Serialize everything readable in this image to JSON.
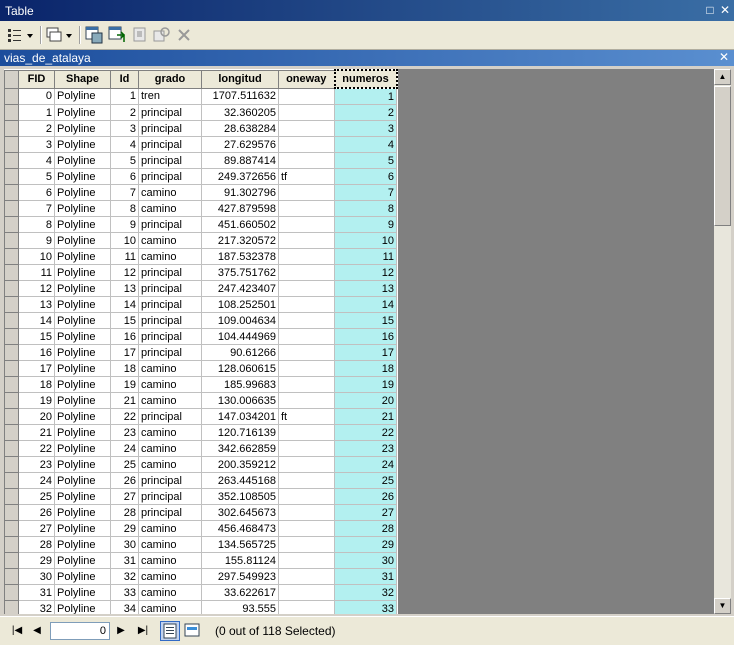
{
  "window": {
    "title": "Table"
  },
  "tab": {
    "title": "vias_de_atalaya"
  },
  "columns": [
    "FID",
    "Shape",
    "Id",
    "grado",
    "longitud",
    "oneway",
    "numeros"
  ],
  "rows": [
    [
      "0",
      "Polyline",
      "1",
      "tren",
      "1707.511632",
      "",
      "1"
    ],
    [
      "1",
      "Polyline",
      "2",
      "principal",
      "32.360205",
      "",
      "2"
    ],
    [
      "2",
      "Polyline",
      "3",
      "principal",
      "28.638284",
      "",
      "3"
    ],
    [
      "3",
      "Polyline",
      "4",
      "principal",
      "27.629576",
      "",
      "4"
    ],
    [
      "4",
      "Polyline",
      "5",
      "principal",
      "89.887414",
      "",
      "5"
    ],
    [
      "5",
      "Polyline",
      "6",
      "principal",
      "249.372656",
      "tf",
      "6"
    ],
    [
      "6",
      "Polyline",
      "7",
      "camino",
      "91.302796",
      "",
      "7"
    ],
    [
      "7",
      "Polyline",
      "8",
      "camino",
      "427.879598",
      "",
      "8"
    ],
    [
      "8",
      "Polyline",
      "9",
      "principal",
      "451.660502",
      "",
      "9"
    ],
    [
      "9",
      "Polyline",
      "10",
      "camino",
      "217.320572",
      "",
      "10"
    ],
    [
      "10",
      "Polyline",
      "11",
      "camino",
      "187.532378",
      "",
      "11"
    ],
    [
      "11",
      "Polyline",
      "12",
      "principal",
      "375.751762",
      "",
      "12"
    ],
    [
      "12",
      "Polyline",
      "13",
      "principal",
      "247.423407",
      "",
      "13"
    ],
    [
      "13",
      "Polyline",
      "14",
      "principal",
      "108.252501",
      "",
      "14"
    ],
    [
      "14",
      "Polyline",
      "15",
      "principal",
      "109.004634",
      "",
      "15"
    ],
    [
      "15",
      "Polyline",
      "16",
      "principal",
      "104.444969",
      "",
      "16"
    ],
    [
      "16",
      "Polyline",
      "17",
      "principal",
      "90.61266",
      "",
      "17"
    ],
    [
      "17",
      "Polyline",
      "18",
      "camino",
      "128.060615",
      "",
      "18"
    ],
    [
      "18",
      "Polyline",
      "19",
      "camino",
      "185.99683",
      "",
      "19"
    ],
    [
      "19",
      "Polyline",
      "21",
      "camino",
      "130.006635",
      "",
      "20"
    ],
    [
      "20",
      "Polyline",
      "22",
      "principal",
      "147.034201",
      "ft",
      "21"
    ],
    [
      "21",
      "Polyline",
      "23",
      "camino",
      "120.716139",
      "",
      "22"
    ],
    [
      "22",
      "Polyline",
      "24",
      "camino",
      "342.662859",
      "",
      "23"
    ],
    [
      "23",
      "Polyline",
      "25",
      "camino",
      "200.359212",
      "",
      "24"
    ],
    [
      "24",
      "Polyline",
      "26",
      "principal",
      "263.445168",
      "",
      "25"
    ],
    [
      "25",
      "Polyline",
      "27",
      "principal",
      "352.108505",
      "",
      "26"
    ],
    [
      "26",
      "Polyline",
      "28",
      "principal",
      "302.645673",
      "",
      "27"
    ],
    [
      "27",
      "Polyline",
      "29",
      "camino",
      "456.468473",
      "",
      "28"
    ],
    [
      "28",
      "Polyline",
      "30",
      "camino",
      "134.565725",
      "",
      "29"
    ],
    [
      "29",
      "Polyline",
      "31",
      "camino",
      "155.81124",
      "",
      "30"
    ],
    [
      "30",
      "Polyline",
      "32",
      "camino",
      "297.549923",
      "",
      "31"
    ],
    [
      "31",
      "Polyline",
      "33",
      "camino",
      "33.622617",
      "",
      "32"
    ],
    [
      "32",
      "Polyline",
      "34",
      "camino",
      "93.555",
      "",
      "33"
    ]
  ],
  "highlight_color": "#b3f0f0",
  "status": {
    "record": "0",
    "selection": "(0 out of 118 Selected)"
  },
  "toolbar_icons": [
    "table-options-icon",
    "related-tables-icon",
    "select-by-attributes-icon",
    "switch-selection-icon",
    "clear-selection-icon",
    "zoom-to-selected-icon",
    "delete-selected-icon"
  ]
}
